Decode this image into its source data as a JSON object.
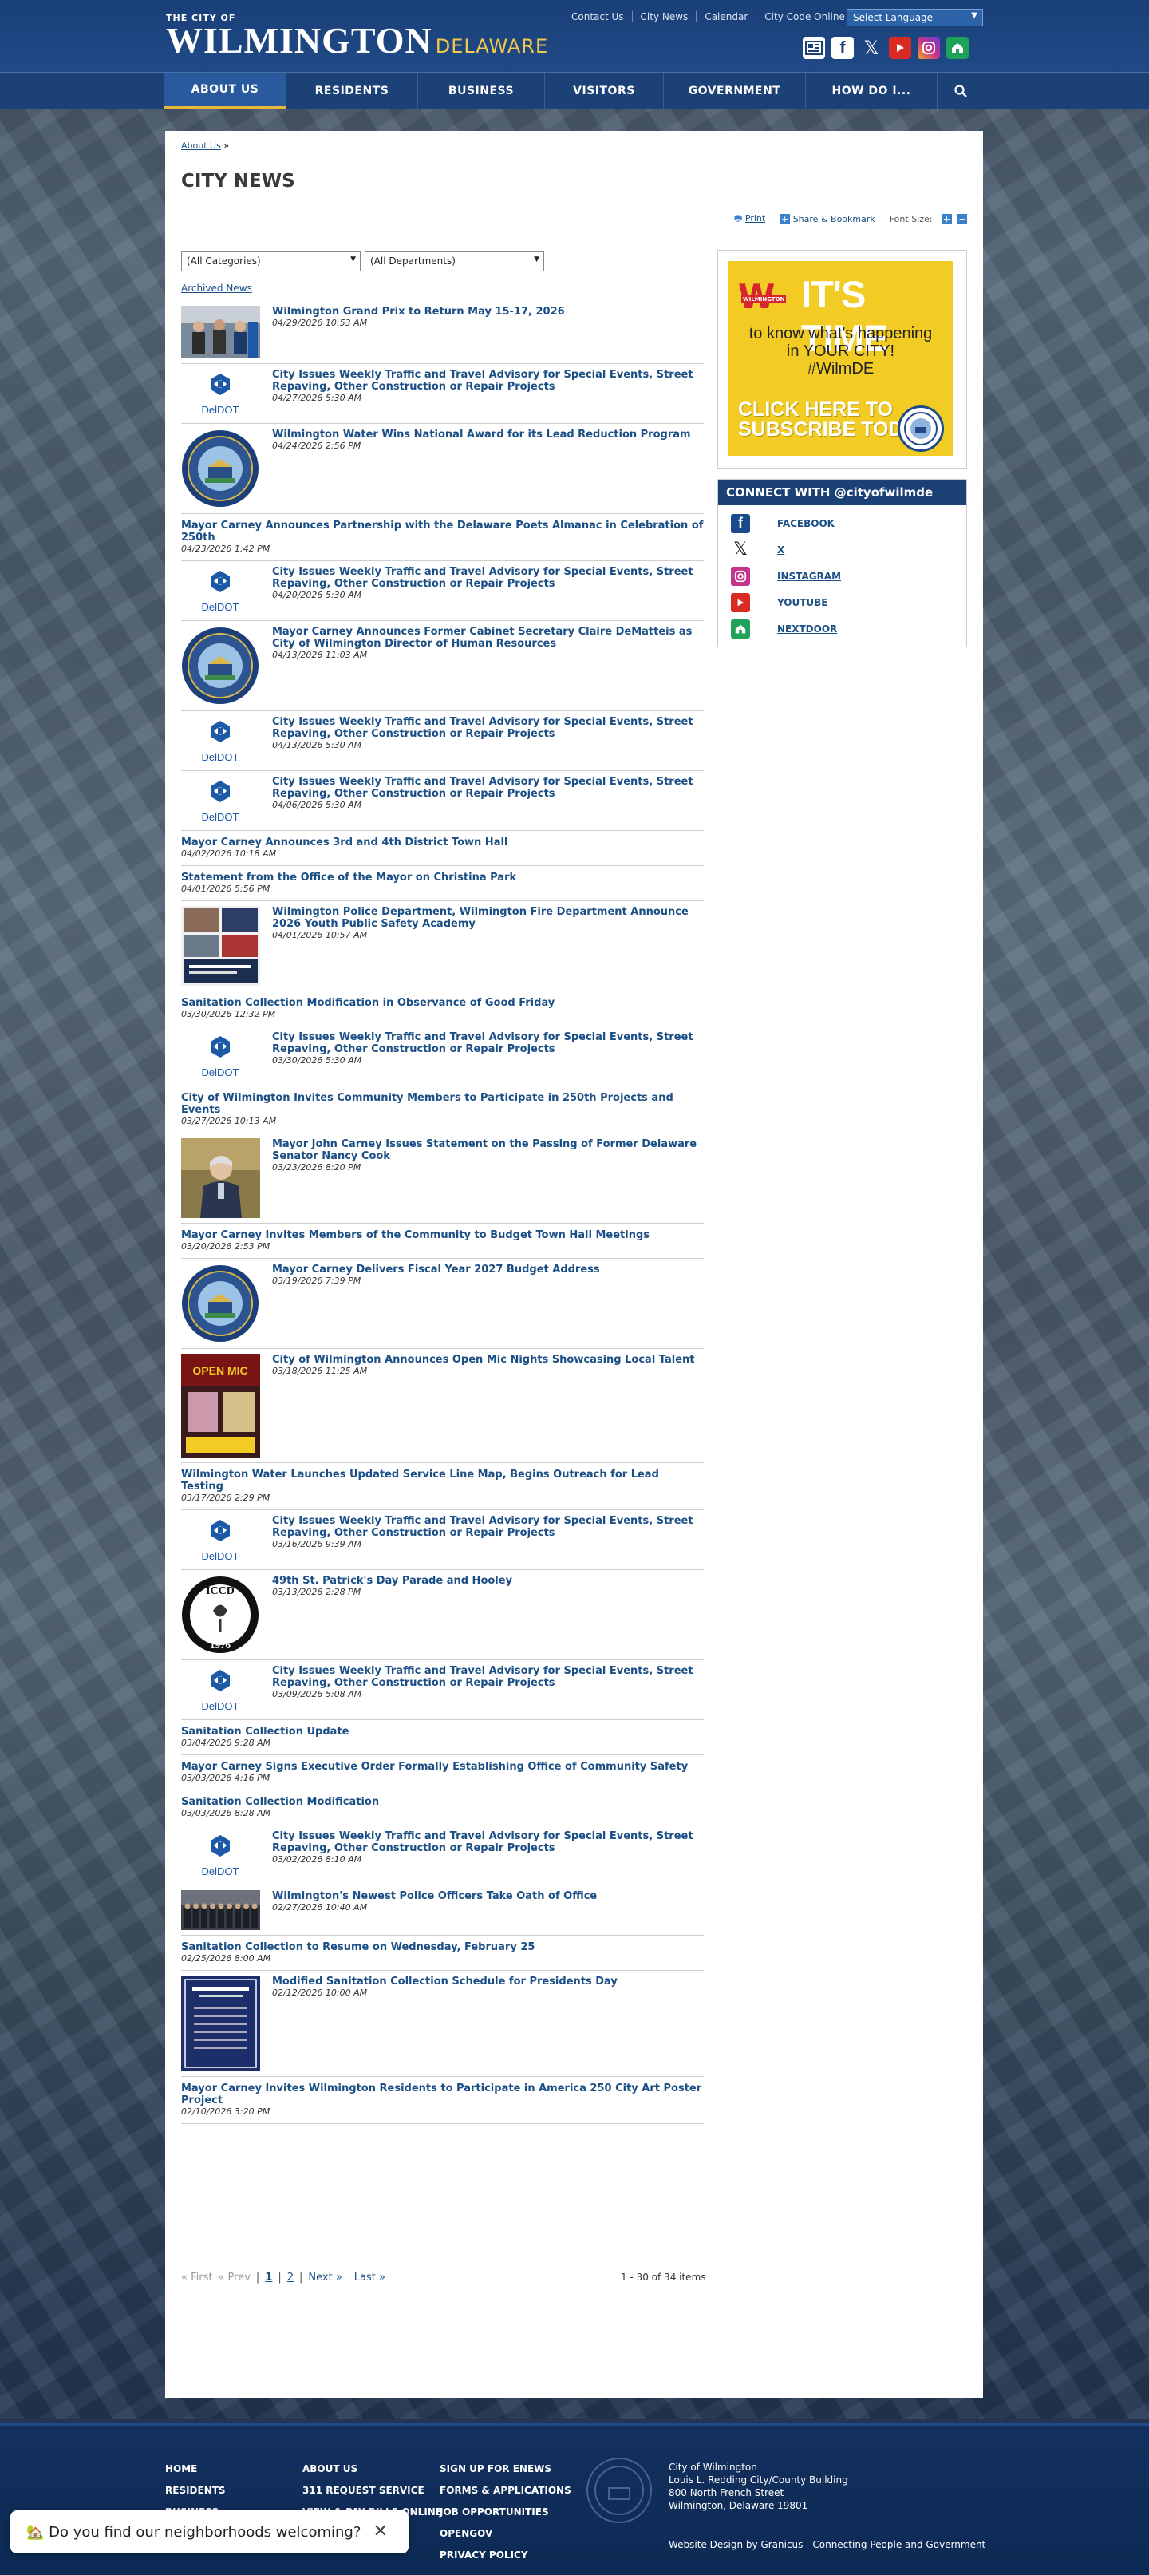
{
  "header": {
    "logo_top": "THE CITY OF",
    "logo_city": "WILMINGTON",
    "logo_state": "DELAWARE",
    "top_links": [
      "Contact Us",
      "City News",
      "Calendar",
      "City Code Online"
    ],
    "language_select": "Select Language",
    "social_icons": [
      "news-icon",
      "facebook-icon",
      "x-icon",
      "youtube-icon",
      "instagram-icon",
      "nextdoor-icon"
    ]
  },
  "nav": {
    "items": [
      "ABOUT US",
      "RESIDENTS",
      "BUSINESS",
      "VISITORS",
      "GOVERNMENT",
      "HOW DO I..."
    ],
    "active_index": 0
  },
  "page": {
    "breadcrumb": "About Us",
    "breadcrumb_sep": "»",
    "title": "CITY NEWS",
    "print": "Print",
    "share": "Share & Bookmark",
    "font_size_label": "Font Size:",
    "font_plus": "+",
    "font_minus": "−",
    "filter_categories": "(All Categories)",
    "filter_departments": "(All Departments)",
    "archived_link": "Archived News"
  },
  "news": [
    {
      "title": "Wilmington Grand Prix to Return May 15-17, 2026",
      "date": "04/29/2026 10:53 AM",
      "thumb": "photo-cyclists"
    },
    {
      "title": "City Issues Weekly Traffic and Travel Advisory for Special Events, Street Repaving, Other Construction or Repair Projects",
      "date": "04/27/2026 5:30 AM",
      "thumb": "deldot"
    },
    {
      "title": "Wilmington Water Wins National Award for its Lead Reduction Program",
      "date": "04/24/2026 2:56 PM",
      "thumb": "seal"
    },
    {
      "title": "Mayor Carney Announces Partnership with the Delaware Poets Almanac in Celebration of 250th",
      "date": "04/23/2026 1:42 PM",
      "thumb": ""
    },
    {
      "title": "City Issues Weekly Traffic and Travel Advisory for Special Events, Street Repaving, Other Construction or Repair Projects",
      "date": "04/20/2026 5:30 AM",
      "thumb": "deldot"
    },
    {
      "title": "Mayor Carney Announces Former Cabinet Secretary Claire DeMatteis as City of Wilmington Director of Human Resources",
      "date": "04/13/2026 11:03 AM",
      "thumb": "seal"
    },
    {
      "title": "City Issues Weekly Traffic and Travel Advisory for Special Events, Street Repaving, Other Construction or Repair Projects",
      "date": "04/13/2026 5:30 AM",
      "thumb": "deldot"
    },
    {
      "title": "City Issues Weekly Traffic and Travel Advisory for Special Events, Street Repaving, Other Construction or Repair Projects",
      "date": "04/06/2026 5:30 AM",
      "thumb": "deldot"
    },
    {
      "title": "Mayor Carney Announces 3rd and 4th District Town Hall",
      "date": "04/02/2026 10:18 AM",
      "thumb": ""
    },
    {
      "title": "Statement from the Office of the Mayor on Christina Park",
      "date": "04/01/2026 5:56 PM",
      "thumb": ""
    },
    {
      "title": "Wilmington Police Department, Wilmington Fire Department Announce 2026 Youth Public Safety Academy",
      "date": "04/01/2026 10:57 AM",
      "thumb": "flyer-academy"
    },
    {
      "title": "Sanitation Collection Modification in Observance of Good Friday",
      "date": "03/30/2026 12:32 PM",
      "thumb": ""
    },
    {
      "title": "City Issues Weekly Traffic and Travel Advisory for Special Events, Street Repaving, Other Construction or Repair Projects",
      "date": "03/30/2026 5:30 AM",
      "thumb": "deldot"
    },
    {
      "title": "City of Wilmington Invites Community Members to Participate in 250th Projects and Events",
      "date": "03/27/2026 10:13 AM",
      "thumb": ""
    },
    {
      "title": "Mayor John Carney Issues Statement on the Passing of Former Delaware Senator Nancy Cook",
      "date": "03/23/2026 8:20 PM",
      "thumb": "photo-portrait"
    },
    {
      "title": "Mayor Carney Invites Members of the Community to Budget Town Hall Meetings",
      "date": "03/20/2026 2:53 PM",
      "thumb": ""
    },
    {
      "title": "Mayor Carney Delivers Fiscal Year 2027 Budget Address",
      "date": "03/19/2026 7:39 PM",
      "thumb": "seal"
    },
    {
      "title": "City of Wilmington Announces Open Mic Nights Showcasing Local Talent",
      "date": "03/18/2026 11:25 AM",
      "thumb": "flyer-openmic"
    },
    {
      "title": "Wilmington Water Launches Updated Service Line Map, Begins Outreach for Lead Testing",
      "date": "03/17/2026 2:29 PM",
      "thumb": ""
    },
    {
      "title": "City Issues Weekly Traffic and Travel Advisory for Special Events, Street Repaving, Other Construction or Repair Projects",
      "date": "03/16/2026 9:39 AM",
      "thumb": "deldot"
    },
    {
      "title": "49th St. Patrick's Day Parade and Hooley",
      "date": "03/13/2026 2:28 PM",
      "thumb": "irish-seal"
    },
    {
      "title": "City Issues Weekly Traffic and Travel Advisory for Special Events, Street Repaving, Other Construction or Repair Projects",
      "date": "03/09/2026 5:08 AM",
      "thumb": "deldot"
    },
    {
      "title": "Sanitation Collection Update",
      "date": "03/04/2026 9:28 AM",
      "thumb": ""
    },
    {
      "title": "Mayor Carney Signs Executive Order Formally Establishing Office of Community Safety",
      "date": "03/03/2026 4:16 PM",
      "thumb": ""
    },
    {
      "title": "Sanitation Collection Modification",
      "date": "03/03/2026 8:28 AM",
      "thumb": ""
    },
    {
      "title": "City Issues Weekly Traffic and Travel Advisory for Special Events, Street Repaving, Other Construction or Repair Projects",
      "date": "03/02/2026 8:10 AM",
      "thumb": "deldot"
    },
    {
      "title": "Wilmington's Newest Police Officers Take Oath of Office",
      "date": "02/27/2026 10:40 AM",
      "thumb": "photo-group"
    },
    {
      "title": "Sanitation Collection to Resume on Wednesday, February 25",
      "date": "02/25/2026 8:00 AM",
      "thumb": ""
    },
    {
      "title": "Modified Sanitation Collection Schedule for Presidents Day",
      "date": "02/12/2026 10:00 AM",
      "thumb": "flyer-sanitation"
    },
    {
      "title": "Mayor Carney Invites Wilmington Residents to Participate in America 250 City Art Poster Project",
      "date": "02/10/2026 3:20 PM",
      "thumb": ""
    }
  ],
  "pager": {
    "first": "« First",
    "prev": "« Prev",
    "sep": "|",
    "pages": [
      "1",
      "2"
    ],
    "current": "1",
    "next": "Next »",
    "last": "Last »",
    "count": "1 - 30 of 34 items"
  },
  "sidebar": {
    "ad_w": "W",
    "ad_wtext": "WILMINGTON",
    "ad_headline": "IT'S TIME",
    "ad_line1": "to know what's happening",
    "ad_line2": "in YOUR CITY!",
    "ad_hashtag": "#WilmDE",
    "ad_cta1": "CLICK HERE TO",
    "ad_cta2": "SUBSCRIBE TODAY",
    "connect_title": "CONNECT WITH @cityofwilmde",
    "social": [
      {
        "name": "FACEBOOK",
        "icon": "facebook-icon",
        "color": "#1a4a8c"
      },
      {
        "name": "X",
        "icon": "x-icon",
        "color": "#ffffff"
      },
      {
        "name": "INSTAGRAM",
        "icon": "instagram-icon",
        "color": "#c6338c"
      },
      {
        "name": "YOUTUBE",
        "icon": "youtube-icon",
        "color": "#d92b24"
      },
      {
        "name": "NEXTDOOR",
        "icon": "nextdoor-icon",
        "color": "#1fa35b"
      }
    ]
  },
  "footer": {
    "col1": [
      "HOME",
      "RESIDENTS",
      "BUSINESS"
    ],
    "col2": [
      "ABOUT US",
      "311 REQUEST SERVICE",
      "VIEW & PAY BILLS ONLINE"
    ],
    "col3": [
      "SIGN UP FOR ENEWS",
      "FORMS & APPLICATIONS",
      "JOB OPPORTUNITIES",
      "OPENGOV",
      "PRIVACY POLICY"
    ],
    "address": [
      "City of Wilmington",
      "Louis L. Redding City/County Building",
      "800 North French Street",
      "Wilmington, Delaware 19801"
    ],
    "credit": "Website Design by Granicus - Connecting People and Government"
  },
  "poll": {
    "text": "🏡 Do you find our neighborhoods welcoming?",
    "close": "✕"
  },
  "colors": {
    "brand_blue": "#1c4177",
    "link": "#1b4f85",
    "accent_gold": "#e6b93a",
    "ad_yellow": "#f2cc24"
  }
}
